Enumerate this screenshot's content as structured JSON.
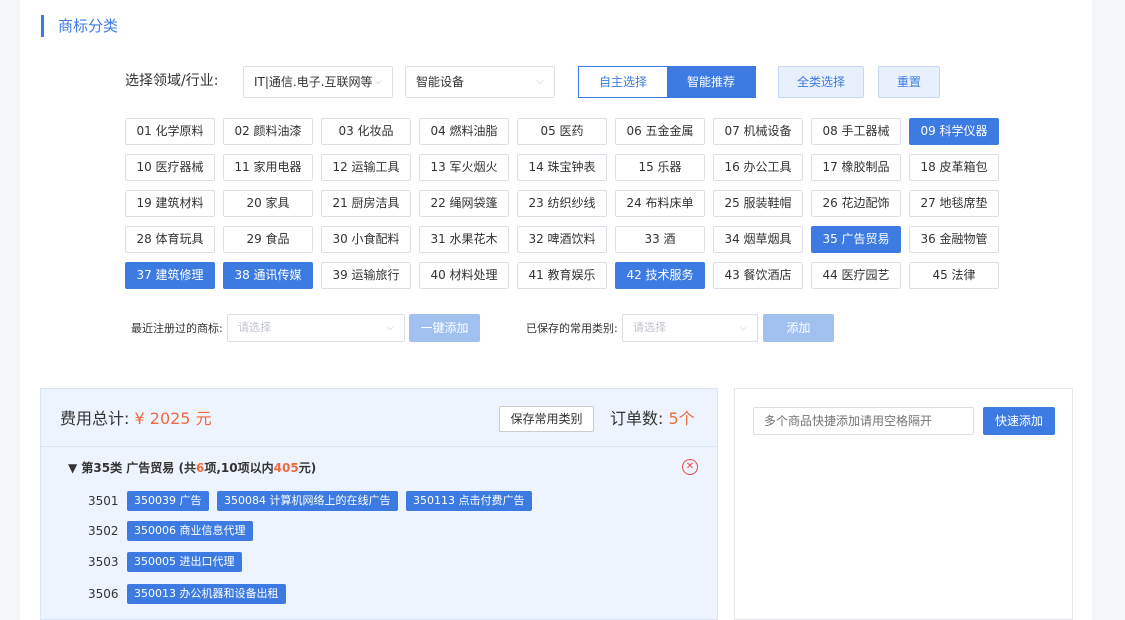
{
  "section_title": "商标分类",
  "filter": {
    "label": "选择领域/行业:",
    "industry_value": "IT|通信.电子.互联网等",
    "subindustry_value": "智能设备",
    "mode_self": "自主选择",
    "mode_smart": "智能推荐",
    "select_all": "全类选择",
    "reset": "重置"
  },
  "categories": [
    {
      "label": "01 化学原料",
      "selected": false
    },
    {
      "label": "02 颜料油漆",
      "selected": false
    },
    {
      "label": "03 化妆品",
      "selected": false
    },
    {
      "label": "04 燃料油脂",
      "selected": false
    },
    {
      "label": "05 医药",
      "selected": false
    },
    {
      "label": "06 五金金属",
      "selected": false
    },
    {
      "label": "07 机械设备",
      "selected": false
    },
    {
      "label": "08 手工器械",
      "selected": false
    },
    {
      "label": "09 科学仪器",
      "selected": true
    },
    {
      "label": "10 医疗器械",
      "selected": false
    },
    {
      "label": "11 家用电器",
      "selected": false
    },
    {
      "label": "12 运输工具",
      "selected": false
    },
    {
      "label": "13 军火烟火",
      "selected": false
    },
    {
      "label": "14 珠宝钟表",
      "selected": false
    },
    {
      "label": "15 乐器",
      "selected": false
    },
    {
      "label": "16 办公工具",
      "selected": false
    },
    {
      "label": "17 橡胶制品",
      "selected": false
    },
    {
      "label": "18 皮革箱包",
      "selected": false
    },
    {
      "label": "19 建筑材料",
      "selected": false
    },
    {
      "label": "20 家具",
      "selected": false
    },
    {
      "label": "21 厨房洁具",
      "selected": false
    },
    {
      "label": "22 绳网袋篷",
      "selected": false
    },
    {
      "label": "23 纺织纱线",
      "selected": false
    },
    {
      "label": "24 布料床单",
      "selected": false
    },
    {
      "label": "25 服装鞋帽",
      "selected": false
    },
    {
      "label": "26 花边配饰",
      "selected": false
    },
    {
      "label": "27 地毯席垫",
      "selected": false
    },
    {
      "label": "28 体育玩具",
      "selected": false
    },
    {
      "label": "29 食品",
      "selected": false
    },
    {
      "label": "30 小食配料",
      "selected": false
    },
    {
      "label": "31 水果花木",
      "selected": false
    },
    {
      "label": "32 啤酒饮料",
      "selected": false
    },
    {
      "label": "33 酒",
      "selected": false
    },
    {
      "label": "34 烟草烟具",
      "selected": false
    },
    {
      "label": "35 广告贸易",
      "selected": true
    },
    {
      "label": "36 金融物管",
      "selected": false
    },
    {
      "label": "37 建筑修理",
      "selected": true
    },
    {
      "label": "38 通讯传媒",
      "selected": true
    },
    {
      "label": "39 运输旅行",
      "selected": false
    },
    {
      "label": "40 材料处理",
      "selected": false
    },
    {
      "label": "41 教育娱乐",
      "selected": false
    },
    {
      "label": "42 技术服务",
      "selected": true
    },
    {
      "label": "43 餐饮酒店",
      "selected": false
    },
    {
      "label": "44 医疗园艺",
      "selected": false
    },
    {
      "label": "45 法律",
      "selected": false
    }
  ],
  "recent": {
    "label": "最近注册过的商标:",
    "placeholder": "请选择",
    "button": "一键添加"
  },
  "saved": {
    "label": "已保存的常用类别:",
    "placeholder": "请选择",
    "button": "添加"
  },
  "summary": {
    "cost_label": "费用总计:",
    "cost_value": "¥ 2025 元",
    "save_button": "保存常用类别",
    "order_label": "订单数:",
    "order_value": "5个"
  },
  "group": {
    "arrow": "▼",
    "class_label": "第35类 广告贸易",
    "info_prefix": "(共",
    "item_count": "6",
    "info_middle": "项,10项以内",
    "price": "405",
    "info_suffix": "元)",
    "rows": [
      {
        "code": "3501",
        "tags": [
          "350039 广告",
          "350084 计算机网络上的在线广告",
          "350113 点击付费广告"
        ]
      },
      {
        "code": "3502",
        "tags": [
          "350006 商业信息代理"
        ]
      },
      {
        "code": "3503",
        "tags": [
          "350005 进出口代理"
        ]
      },
      {
        "code": "3506",
        "tags": [
          "350013 办公机器和设备出租"
        ]
      }
    ]
  },
  "quick_add": {
    "placeholder": "多个商品快捷添加请用空格隔开",
    "button": "快速添加"
  },
  "colors": {
    "accent": "#3d7be3",
    "highlight": "#f06a40",
    "danger": "#e8494a"
  }
}
